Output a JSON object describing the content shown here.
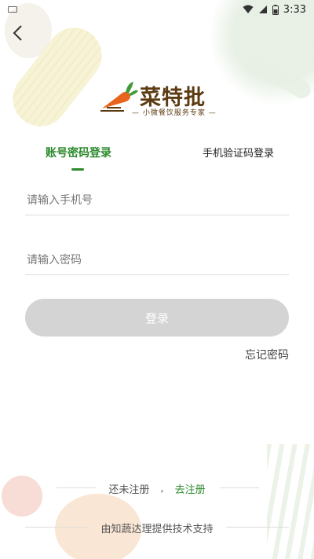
{
  "status_bar": {
    "time": "3:33"
  },
  "logo": {
    "title": "菜特批",
    "subtitle": "— 小微餐饮服务专家 —"
  },
  "tabs": [
    {
      "label": "账号密码登录",
      "active": true
    },
    {
      "label": "手机验证码登录",
      "active": false
    }
  ],
  "form": {
    "phone_placeholder": "请输入手机号",
    "phone_value": "",
    "password_placeholder": "请输入密码",
    "password_value": ""
  },
  "login_button": "登录",
  "forgot_password": "忘记密码",
  "register": {
    "prompt": "还未注册",
    "separator": ",",
    "link": "去注册"
  },
  "powered_by": "由知蔬达理提供技术支持",
  "colors": {
    "accent": "#2d8a2d",
    "brand_brown": "#5c3a12",
    "carrot": "#e8641e",
    "button_disabled": "#d4d4d4"
  }
}
